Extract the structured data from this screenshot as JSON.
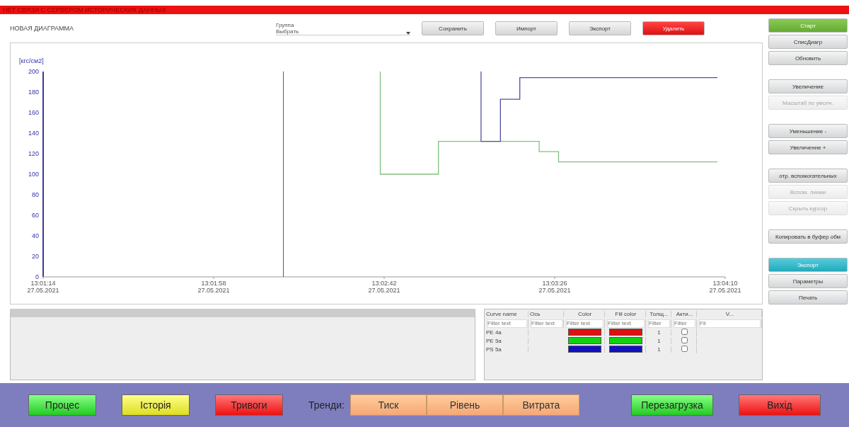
{
  "alert_bar": {
    "text": "НЕТ СВЯЗИ С СЕРВЕРОМ ИСТОРИЧЕСКИХ ДАННЫХ"
  },
  "header": {
    "title": "НОВАЯ ДИАГРАММА",
    "group_label": "Группа",
    "group_value": "Выбрать",
    "buttons": [
      {
        "label": "Сохранить",
        "kind": "normal"
      },
      {
        "label": "Импорт",
        "kind": "normal"
      },
      {
        "label": "Экспорт",
        "kind": "normal"
      },
      {
        "label": "Удалить",
        "kind": "danger"
      }
    ]
  },
  "side_groups": [
    [
      {
        "label": "Старт",
        "kind": "go",
        "disabled": false
      },
      {
        "label": "СписДиагр",
        "kind": "normal",
        "disabled": false
      },
      {
        "label": "Обновить",
        "kind": "normal",
        "disabled": false
      }
    ],
    [
      {
        "label": "Увеличение",
        "kind": "normal",
        "disabled": false
      },
      {
        "label": "Масштаб по умолч.",
        "kind": "normal",
        "disabled": true
      }
    ],
    [
      {
        "label": "Уменьшение -",
        "kind": "normal",
        "disabled": false
      },
      {
        "label": "Увеличение +",
        "kind": "normal",
        "disabled": false
      }
    ],
    [
      {
        "label": "отр. вспомогательных",
        "kind": "normal",
        "disabled": false
      },
      {
        "label": "Вспом. линии",
        "kind": "normal",
        "disabled": true
      },
      {
        "label": "Скрыть курсор",
        "kind": "normal",
        "disabled": true
      }
    ],
    [
      {
        "label": "Копировать в буфер обм",
        "kind": "normal",
        "disabled": false
      }
    ],
    [
      {
        "label": "Экспорт",
        "kind": "accent",
        "disabled": false
      },
      {
        "label": "Параметры",
        "kind": "normal",
        "disabled": false
      },
      {
        "label": "Печать",
        "kind": "normal",
        "disabled": false
      }
    ]
  ],
  "chart": {
    "chart_data": {
      "type": "line",
      "ylabel": "[кгс/см2]",
      "ylim": [
        0,
        200
      ],
      "yticks": [
        0,
        20,
        40,
        60,
        80,
        100,
        120,
        140,
        160,
        180,
        200
      ],
      "xlim": [
        46874,
        47050
      ],
      "xticks": [
        {
          "value": 46874,
          "label": "13:01:14"
        },
        {
          "value": 46918,
          "label": "13:01:58"
        },
        {
          "value": 46962,
          "label": "13:02:42"
        },
        {
          "value": 47006,
          "label": "13:03:26"
        },
        {
          "value": 47050,
          "label": "13:04:10"
        }
      ],
      "x": [
        46961,
        46961,
        46976,
        46976,
        46987,
        46987,
        46992,
        46992,
        46997,
        46997,
        47002,
        47002,
        47007,
        47007,
        47048
      ],
      "ref_lines": [
        {
          "axis": "x",
          "value": 46936
        }
      ],
      "series": [
        {
          "color": "#80c080",
          "values": [
            200,
            100,
            100,
            132,
            132,
            132,
            132,
            132,
            132,
            132,
            132,
            122,
            122,
            112,
            112
          ]
        },
        {
          "color": "#5050a0",
          "values": [
            null,
            null,
            null,
            null,
            200,
            132,
            132,
            173,
            173,
            194,
            194,
            194,
            194,
            194,
            194
          ]
        }
      ]
    },
    "axis_dates": [
      "27.05.2021",
      "27.05.2021",
      "27.05.2021",
      "27.05.2021",
      "27.05.2021"
    ]
  },
  "curve_table": {
    "columns": [
      "Curve name",
      "Ось",
      "Color",
      "Fill color",
      "Толщ...",
      "Акти...",
      "V..."
    ],
    "filter_placeholders": [
      "Filter text",
      "Filter text",
      "Filter text",
      "Filter text",
      "Filter",
      "Filter",
      "Fil"
    ],
    "rows": [
      {
        "name": "PE 4a",
        "color": "#e01010",
        "thickness": "1",
        "checked": false
      },
      {
        "name": "PE 5a",
        "color": "#10d010",
        "thickness": "1",
        "checked": false
      },
      {
        "name": "PS 5a",
        "color": "#1010c0",
        "thickness": "1",
        "checked": false
      }
    ]
  },
  "nav": {
    "buttons": [
      {
        "label": "Процес",
        "kind": "green"
      },
      {
        "label": "Історія",
        "kind": "yellow"
      },
      {
        "label": "Тривоги",
        "kind": "red"
      }
    ],
    "trends_label": "Тренди:",
    "trend_tabs": [
      {
        "label": "Тиск",
        "selected": false
      },
      {
        "label": "Рівень",
        "selected": false
      },
      {
        "label": "Витрата",
        "selected": false
      }
    ],
    "right_buttons": [
      {
        "label": "Перезагрузка",
        "kind": "green"
      },
      {
        "label": "Вихід",
        "kind": "red"
      }
    ]
  }
}
